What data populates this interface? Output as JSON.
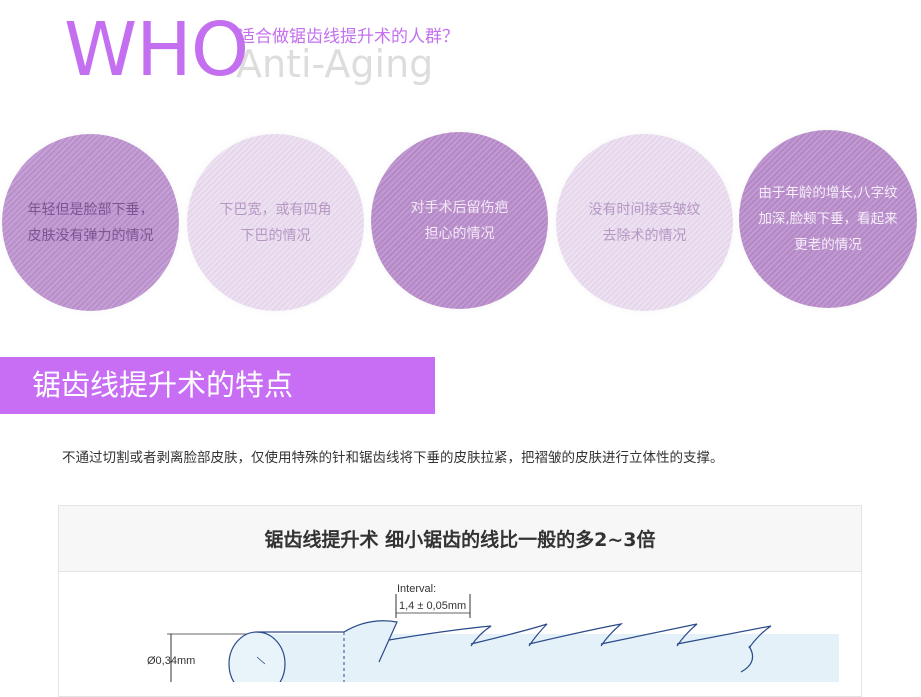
{
  "who": {
    "word": "WHO",
    "subtitle": "适合做锯齿线提升术的人群？",
    "english": "Anti-Aging",
    "circles": [
      {
        "lines": [
          "年轻但是脸部下垂，",
          "皮肤没有弹力的情况"
        ]
      },
      {
        "lines": [
          "下巴宽，或有四角",
          "下巴的情况"
        ]
      },
      {
        "lines": [
          "对手术后留伤疤",
          "担心的情况"
        ]
      },
      {
        "lines": [
          "没有时间接受皱纹",
          "去除术的情况"
        ]
      },
      {
        "lines": [
          "由于年龄的增长,八字纹",
          "加深,脸颊下垂，看起来",
          "更老的情况"
        ]
      }
    ]
  },
  "features": {
    "title": "锯齿线提升术的特点",
    "description": "不通过切割或者剥离脸部皮肤，仅使用特殊的针和锯齿线将下垂的皮肤拉紧，把褶皱的皮肤进行立体性的支撑。",
    "box_title": "锯齿线提升术 细小锯齿的线比一般的多2~3倍",
    "diagram": {
      "interval_label": "Interval:",
      "interval_value": "1,4 ± 0,05mm",
      "diameter_label": "Ø0,34mm"
    }
  },
  "colors": {
    "accent": "#c86ef5",
    "who_text": "#c46ff0",
    "circle_dark": "#b98fcb",
    "circle_light": "#e6d6ec"
  }
}
